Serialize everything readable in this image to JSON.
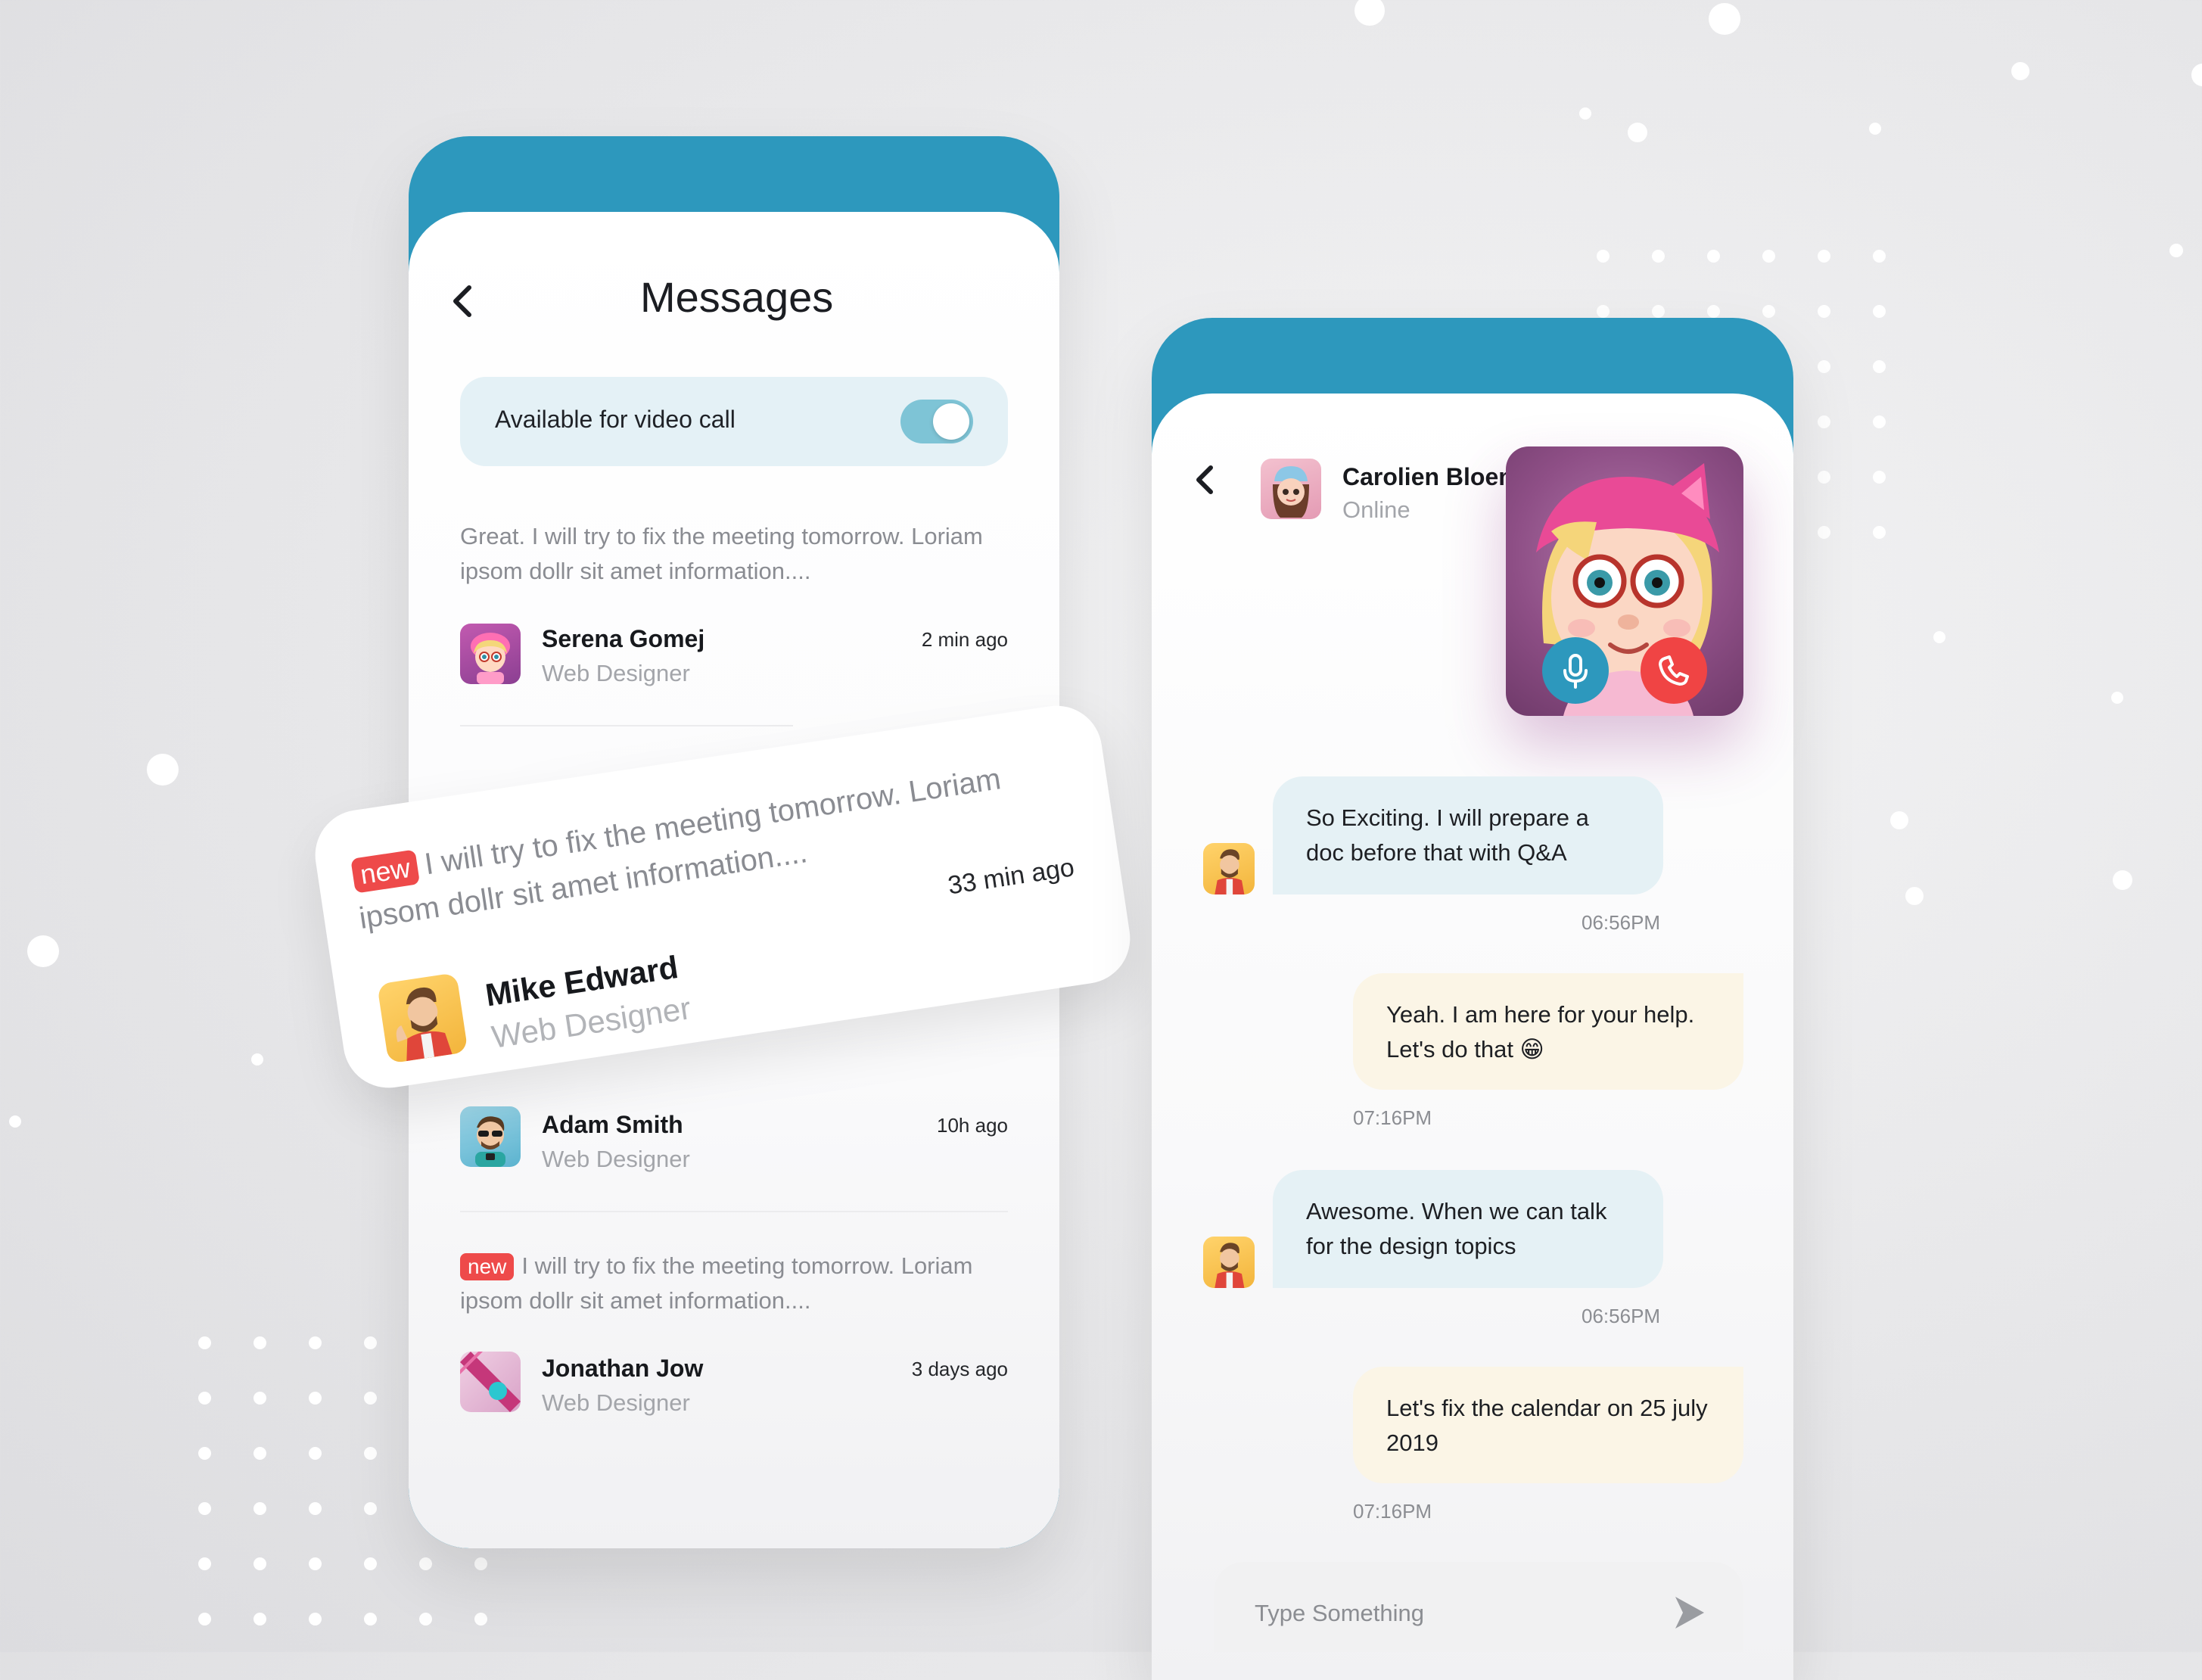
{
  "messages_screen": {
    "title": "Messages",
    "video_toggle": {
      "label": "Available for video call",
      "enabled": true
    },
    "new_badge": "new",
    "items": [
      {
        "preview": "Great. I will try to fix the meeting tomorrow. Loriam ipsom dollr sit amet information....",
        "name": "Serena Gomej",
        "role": "Web Designer",
        "time": "2 min ago",
        "is_new": false
      },
      {
        "preview": "I will try to fix the meeting tomorrow. Loriam ipsom dollr sit amet information....",
        "name": "Mike Edward",
        "role": "Web Designer",
        "time": "33 min ago",
        "is_new": true
      },
      {
        "name": "Adam Smith",
        "role": "Web Designer",
        "time": "10h ago",
        "is_new": false
      },
      {
        "preview": "I will try to fix the meeting tomorrow. Loriam ipsom dollr sit amet information....",
        "name": "Jonathan Jow",
        "role": "Web Designer",
        "time": "3 days ago",
        "is_new": true
      }
    ]
  },
  "chat_screen": {
    "contact_name": "Carolien Bloem",
    "contact_status": "Online",
    "messages": [
      {
        "direction": "in",
        "text": "So Exciting. I will prepare a doc before that with Q&A",
        "time": "06:56PM"
      },
      {
        "direction": "out",
        "text": "Yeah. I am here for your help. Let's do that 😁",
        "time": "07:16PM"
      },
      {
        "direction": "in",
        "text": "Awesome. When we can talk for the design topics",
        "time": "06:56PM"
      },
      {
        "direction": "out",
        "text": "Let's fix the calendar on 25 july 2019",
        "time": "07:16PM"
      }
    ],
    "input_placeholder": "Type Something",
    "call_controls": {
      "mic": "mic-icon",
      "end": "phone-hangup-icon"
    }
  },
  "colors": {
    "header_teal": "#2d98bd",
    "new_badge": "#ee4a4a",
    "incoming_bubble": "#e5f1f5",
    "outgoing_bubble": "#fbf5e6",
    "end_call": "#f04444",
    "mic": "#2d98bd"
  }
}
